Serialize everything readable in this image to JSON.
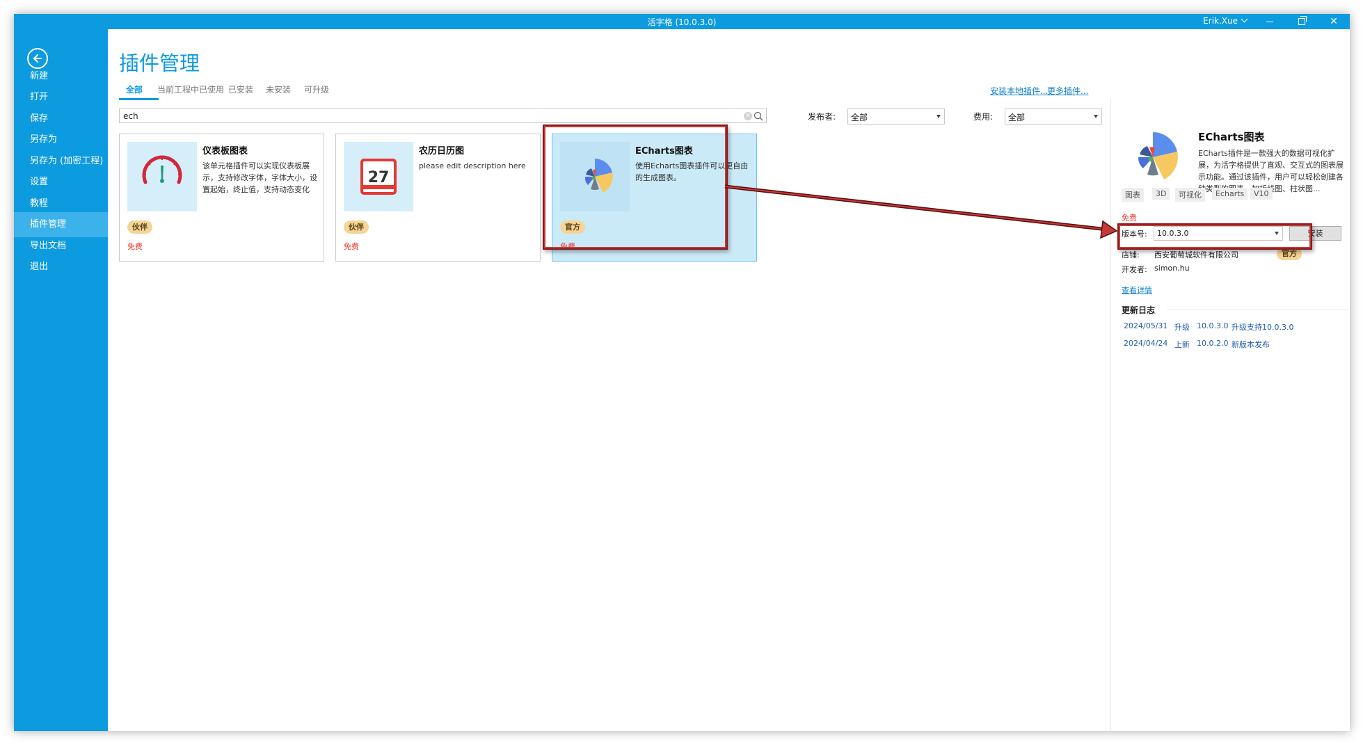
{
  "window": {
    "title": "活字格 (10.0.3.0)",
    "user": "Erik.Xue"
  },
  "sidebar": {
    "items": [
      {
        "label": "新建"
      },
      {
        "label": "打开"
      },
      {
        "label": "保存"
      },
      {
        "label": "另存为"
      },
      {
        "label": "另存为 (加密工程)"
      },
      {
        "label": "设置"
      },
      {
        "label": "教程"
      },
      {
        "label": "插件管理",
        "active": true
      },
      {
        "label": "导出文档"
      },
      {
        "label": "退出"
      }
    ]
  },
  "page": {
    "title": "插件管理",
    "tabs": [
      {
        "label": "全部",
        "active": true
      },
      {
        "label": "当前工程中已使用"
      },
      {
        "label": "已安装"
      },
      {
        "label": "未安装"
      },
      {
        "label": "可升级"
      }
    ],
    "links": {
      "install_local": "安装本地插件...",
      "more_plugins": "更多插件..."
    }
  },
  "search": {
    "value": "ech"
  },
  "filters": {
    "publisher_label": "发布者:",
    "publisher_value": "全部",
    "cost_label": "费用:",
    "cost_value": "全部"
  },
  "plugins": [
    {
      "name": "仪表板图表",
      "description": "该单元格插件可以实现仪表板展示，支持修改字体，字体大小，设置起始，终止值，支持动态变化",
      "badge": "伙伴",
      "price": "免费",
      "icon": "gauge-icon"
    },
    {
      "name": "农历日历图",
      "description": "please edit description here",
      "badge": "伙伴",
      "price": "免费",
      "icon": "calendar-icon",
      "icon_text": "27"
    },
    {
      "name": "ECharts图表",
      "description": "使用Echarts图表插件可以更自由的生成图表。",
      "badge": "官方",
      "price": "免费",
      "icon": "echarts-icon",
      "selected": true
    }
  ],
  "detail": {
    "name": "ECharts图表",
    "description": "ECharts插件是一款强大的数据可视化扩展，为活字格提供了直观、交互式的图表展示功能。通过该插件，用户可以轻松创建各种类型的图表，如折线图、柱状图...",
    "tags": [
      "图表",
      "3D",
      "可视化",
      "Echarts",
      "V10"
    ],
    "price": "免费",
    "version_label": "版本号:",
    "version_value": "10.0.3.0",
    "install_label": "安装",
    "shop_label": "店铺:",
    "shop_value": "西安葡萄城软件有限公司",
    "shop_badge": "官方",
    "developer_label": "开发者:",
    "developer_value": "simon.hu",
    "view_details": "查看详情",
    "changelog_title": "更新日志",
    "changelog": [
      {
        "date": "2024/05/31",
        "type": "升级",
        "version": "10.0.3.0",
        "note": "升级支持10.0.3.0"
      },
      {
        "date": "2024/04/24",
        "type": "上新",
        "version": "10.0.2.0",
        "note": "新版本发布"
      }
    ]
  },
  "colors": {
    "accent": "#0d9be0",
    "free": "#e83e2e",
    "badge": "#f4d597",
    "highlight": "#8b1a1a"
  }
}
